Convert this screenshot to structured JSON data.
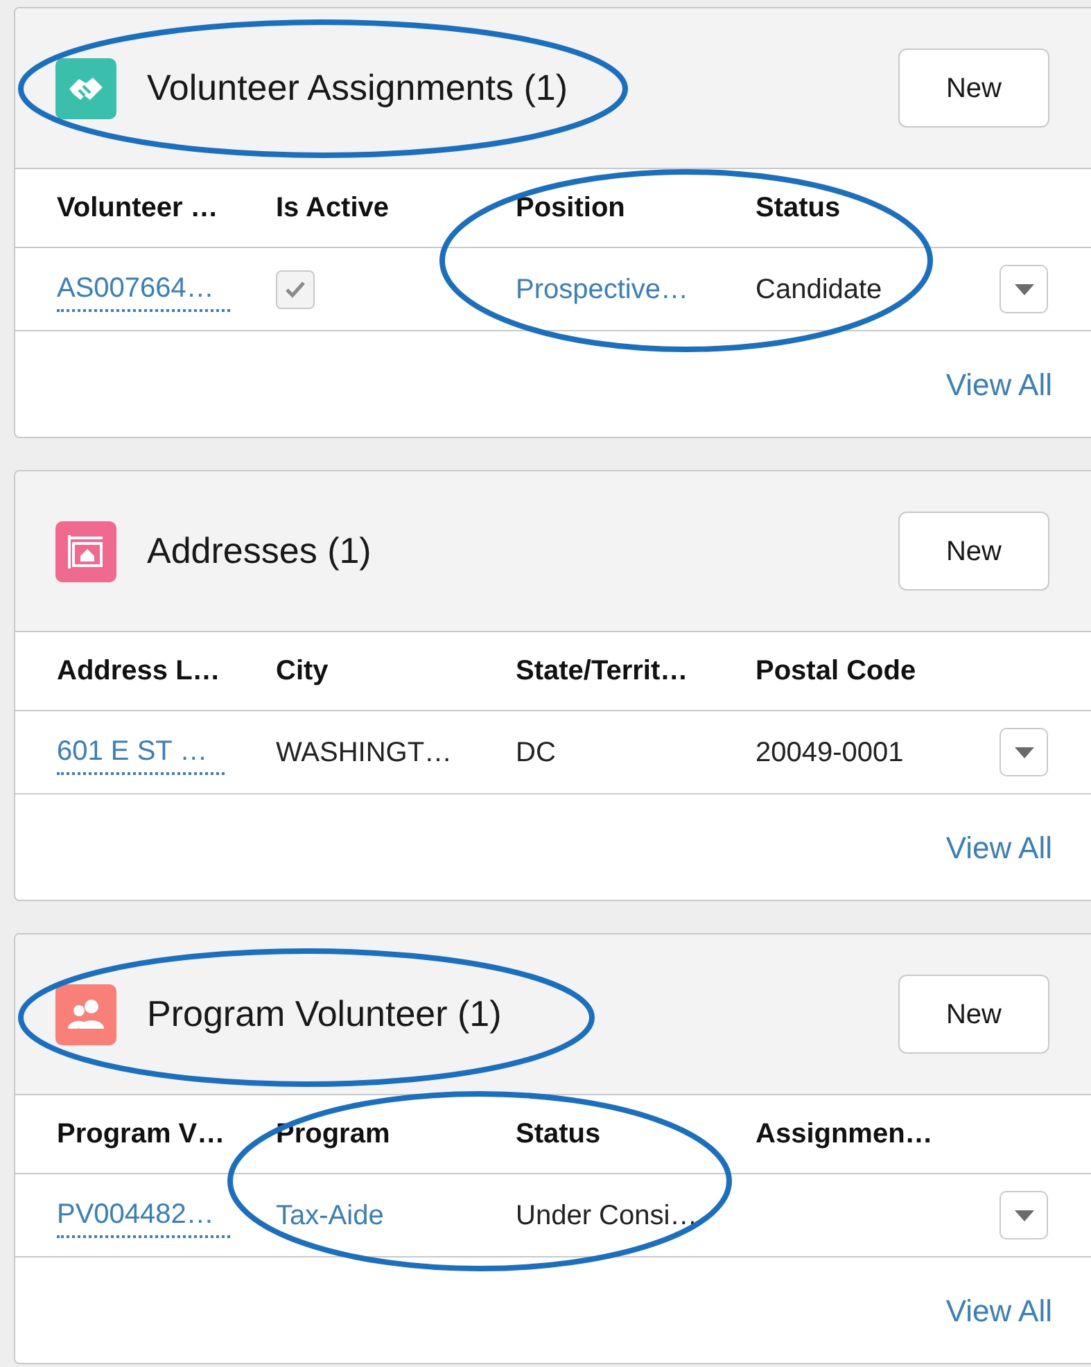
{
  "cards": [
    {
      "kind": "handshake",
      "title": "Volunteer Assignments (1)",
      "new_button": "New",
      "columns": [
        "Volunteer …",
        "Is Active",
        "Position",
        "Status"
      ],
      "rows": [
        {
          "cells": [
            {
              "kind": "link",
              "text": "AS007664…"
            },
            {
              "kind": "checkbox",
              "checked": true
            },
            {
              "kind": "link",
              "text": "Prospective…"
            },
            {
              "kind": "text",
              "text": "Candidate"
            }
          ]
        }
      ],
      "view_all": "View All"
    },
    {
      "kind": "address",
      "title": "Addresses (1)",
      "new_button": "New",
      "columns": [
        "Address L…",
        "City",
        "State/Territ…",
        "Postal Code"
      ],
      "rows": [
        {
          "cells": [
            {
              "kind": "link",
              "text": "601 E ST …"
            },
            {
              "kind": "text",
              "text": "WASHINGT…"
            },
            {
              "kind": "text",
              "text": "DC"
            },
            {
              "kind": "text",
              "text": "20049-0001"
            }
          ]
        }
      ],
      "view_all": "View All"
    },
    {
      "kind": "people",
      "title": "Program Volunteer (1)",
      "new_button": "New",
      "columns": [
        "Program V…",
        "Program",
        "Status",
        "Assignmen…"
      ],
      "rows": [
        {
          "cells": [
            {
              "kind": "link",
              "text": "PV004482…"
            },
            {
              "kind": "link",
              "text": "Tax-Aide"
            },
            {
              "kind": "text",
              "text": "Under Consi…"
            }
          ]
        }
      ],
      "view_all": "View All"
    }
  ]
}
